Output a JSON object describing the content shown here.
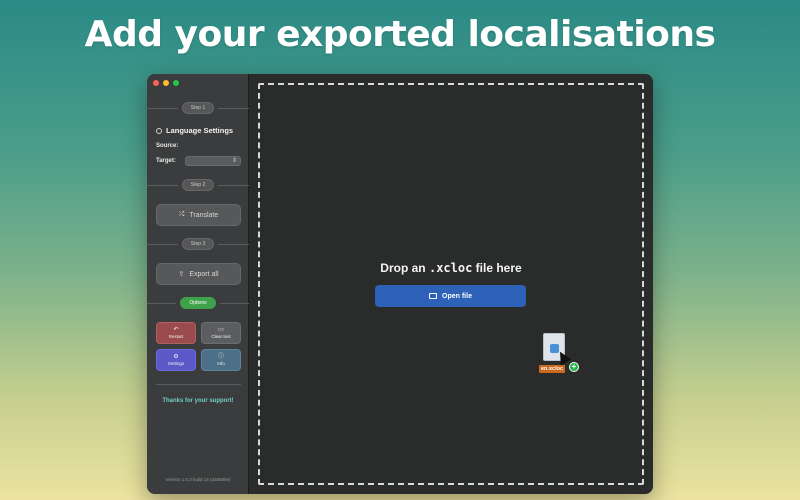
{
  "headline": "Add your exported localisations",
  "sidebar": {
    "step1": "Step 1",
    "language_settings": "Language Settings",
    "source_label": "Source:",
    "target_label": "Target:",
    "target_value": "",
    "step2": "Step 2",
    "translate_label": "Translate",
    "step3": "Step 3",
    "export_label": "Export all",
    "options_label": "Options",
    "restart_label": "Restart",
    "clear_label": "Clear text",
    "settings_label": "Settings",
    "info_label": "Info",
    "thanks": "Thanks for your support!",
    "version": "Version 1.0.2 build 14 (a28a80e)"
  },
  "main": {
    "drop_prefix": "Drop an ",
    "drop_ext": ".xcloc",
    "drop_suffix": " file here",
    "open_label": "Open file",
    "dragged_file": "en.xcloc"
  },
  "icons": {
    "translate": "shuffle-icon",
    "export": "share-icon",
    "restart": "undo-icon",
    "clear": "trash-icon",
    "settings": "gear-icon",
    "info": "info-icon",
    "open": "file-icon"
  },
  "colors": {
    "open_button": "#2d62b8",
    "options_pill": "#3fa24a",
    "restart": "#9a4b4b",
    "settings": "#5b58c8",
    "info": "#4b6f86",
    "thanks": "#6fd0c8",
    "file_tag": "#c96a1f"
  }
}
